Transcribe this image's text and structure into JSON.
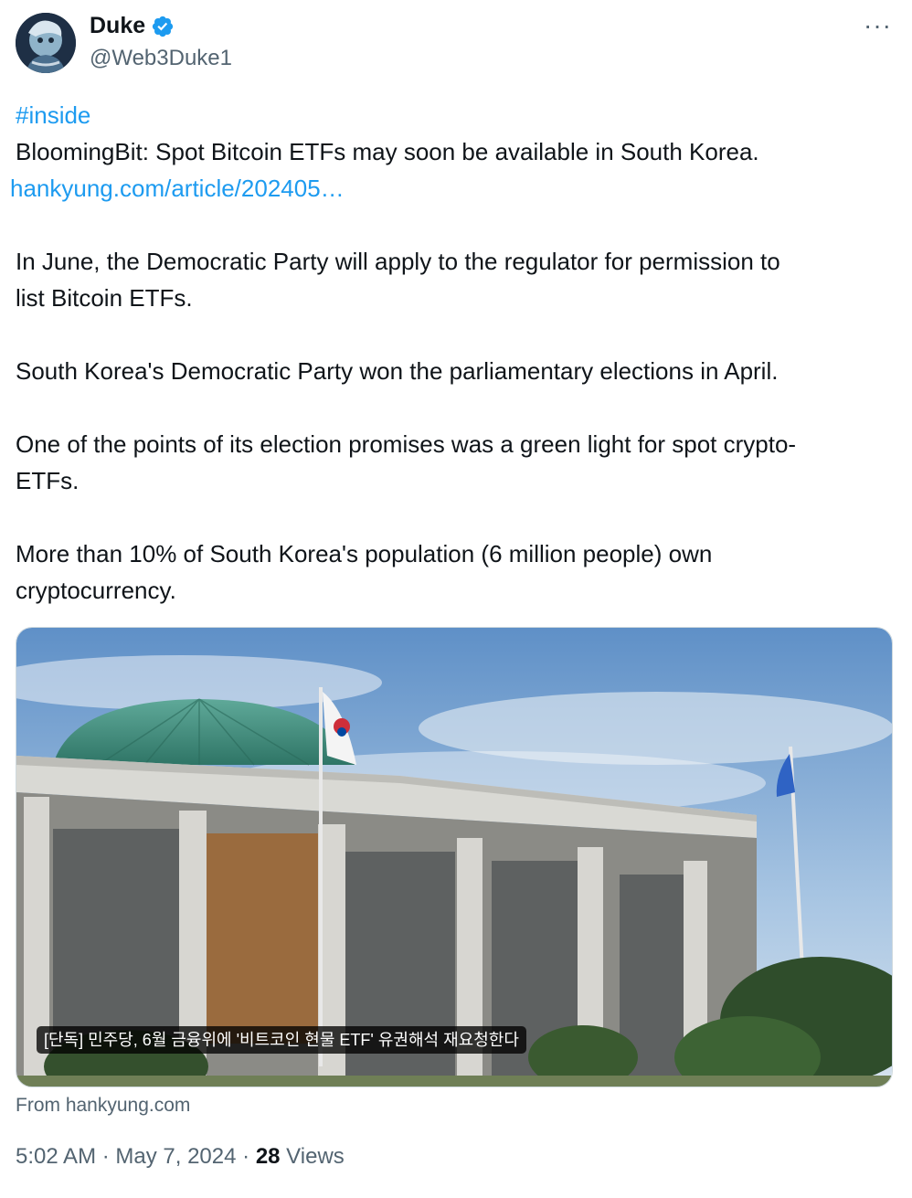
{
  "author": {
    "display_name": "Duke",
    "handle": "@Web3Duke1",
    "avatar_icon": "avatar-image",
    "verified_icon": "verified-badge-icon",
    "verified_color": "#1d9bf0"
  },
  "more_menu": {
    "label": "···"
  },
  "tweet": {
    "hashtag": "#inside",
    "lines": {
      "l1": "BloomingBit: Spot Bitcoin ETFs may soon be available in South Korea.",
      "link": "hankyung.com/article/202405…",
      "l3": "In June, the Democratic Party will apply to the regulator for permission to",
      "l4": "list Bitcoin ETFs.",
      "l5": "South Korea's Democratic Party won the parliamentary elections in April.",
      "l6": "One of the points of its election promises was a green light for spot crypto-",
      "l7": "ETFs.",
      "l8": "More than 10% of South Korea's population (6 million people) own",
      "l9": "cryptocurrency."
    }
  },
  "link_card": {
    "caption": "[단독] 민주당, 6월 금융위에 '비트코인 현물 ETF' 유권해석 재요청한다",
    "source": "From hankyung.com"
  },
  "meta": {
    "time": "5:02 AM",
    "sep1": " · ",
    "date": "May 7, 2024",
    "sep2": " · ",
    "views_count": "28",
    "views_label": " Views"
  },
  "colors": {
    "link": "#1d9bf0",
    "secondary_text": "#536471",
    "primary_text": "#0f1419"
  }
}
